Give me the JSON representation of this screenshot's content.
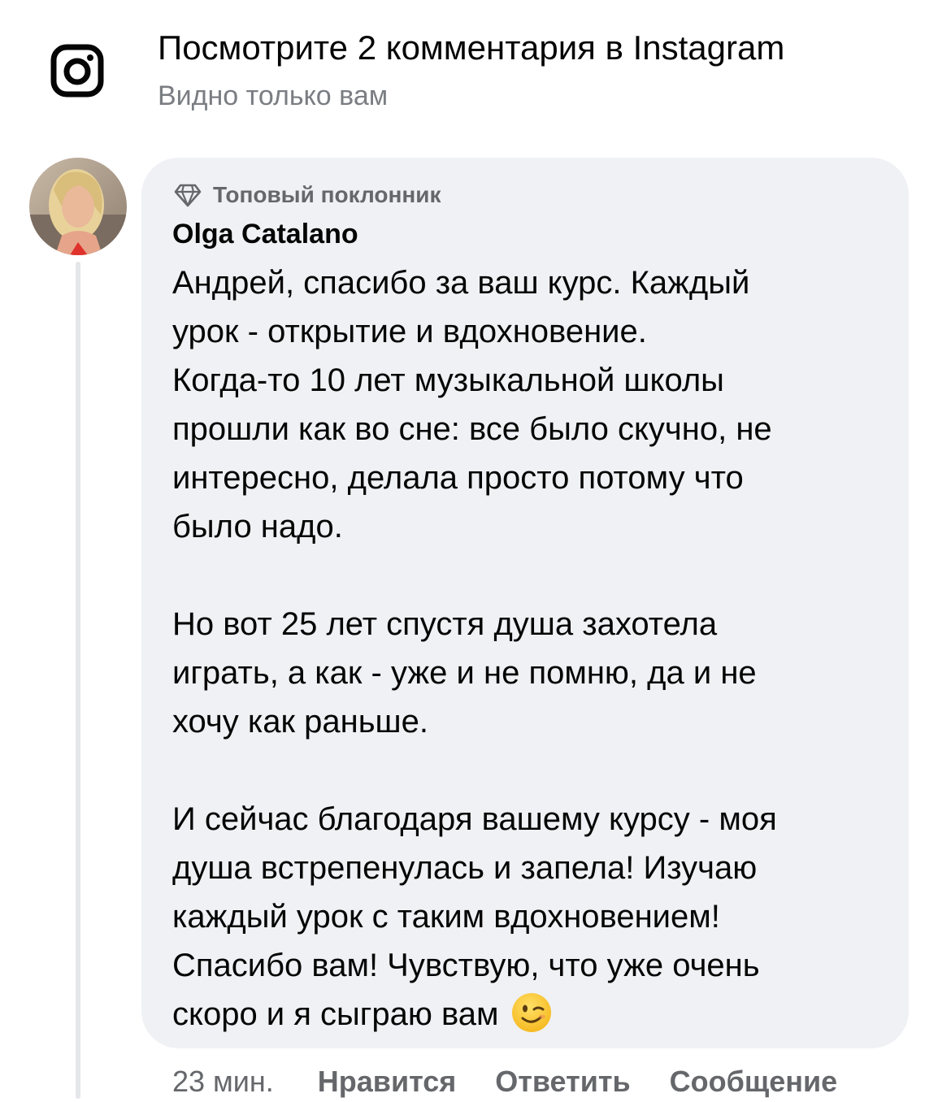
{
  "instagram_banner": {
    "title": "Посмотрите 2 комментария в Instagram",
    "subtitle": "Видно только вам",
    "icon": "instagram-icon"
  },
  "comment": {
    "badge_icon": "diamond-icon",
    "badge_label": "Топовый поклонник",
    "author": "Olga Catalano",
    "lines": [
      "Андрей, спасибо за ваш курс. Каждый",
      "урок - открытие и вдохновение.",
      "Когда-то 10 лет музыкальной школы",
      "прошли как во сне: все было скучно, не",
      "интересно, делала просто потому что",
      "было надо.",
      "",
      "Но вот 25 лет спустя душа захотела",
      "играть, а как - уже и не помню, да и не",
      "хочу как раньше.",
      "",
      "И сейчас благодаря вашему курсу - моя",
      "душа встрепенулась и запела! Изучаю",
      "каждый урок с таким вдохновением!",
      "Спасибо вам! Чувствую, что уже очень",
      "скоро и я сыграю вам"
    ],
    "trailing_emoji": "winking-face-emoji"
  },
  "actions": {
    "time": "23 мин.",
    "like": "Нравится",
    "reply": "Ответить",
    "message": "Сообщение"
  },
  "colors": {
    "bubble_bg": "#f0f1f4",
    "secondary_text": "#65676b",
    "thread_line": "#e4e6ea"
  }
}
